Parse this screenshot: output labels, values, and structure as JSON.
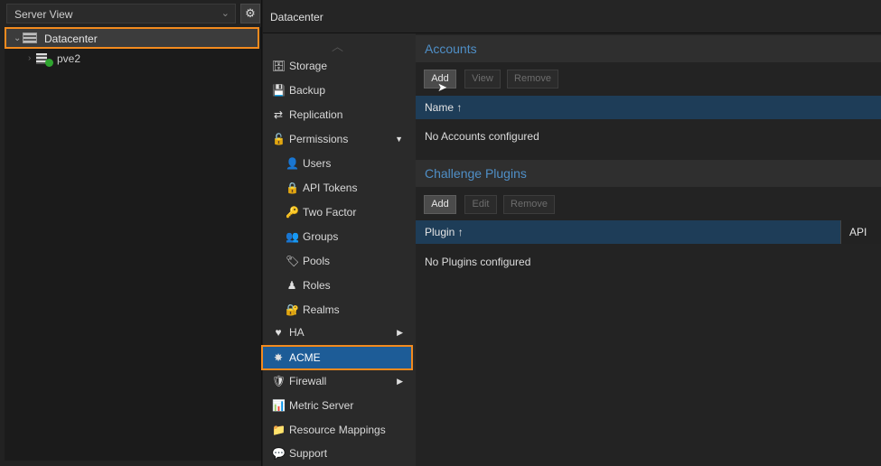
{
  "tree": {
    "view_label": "Server View",
    "view_caret": "⌄",
    "gear": "⚙",
    "nodes": [
      {
        "label": "Datacenter",
        "chevron": "⌄"
      },
      {
        "label": "pve2",
        "chevron": "›"
      }
    ]
  },
  "header": {
    "title": "Datacenter"
  },
  "menu": {
    "scroll_up": "︿",
    "items": [
      {
        "label": "Storage",
        "icon": "🗄"
      },
      {
        "label": "Backup",
        "icon": "💾"
      },
      {
        "label": "Replication",
        "icon": "⇄"
      },
      {
        "label": "Permissions",
        "icon": "🔓",
        "arrow": "▼"
      },
      {
        "label": "Users",
        "icon": "👤"
      },
      {
        "label": "API Tokens",
        "icon": "🔒"
      },
      {
        "label": "Two Factor",
        "icon": "🔑"
      },
      {
        "label": "Groups",
        "icon": "👥"
      },
      {
        "label": "Pools",
        "icon": "🏷"
      },
      {
        "label": "Roles",
        "icon": "♟"
      },
      {
        "label": "Realms",
        "icon": "🔐"
      },
      {
        "label": "HA",
        "icon": "♥",
        "arrow": "▶"
      },
      {
        "label": "ACME",
        "icon": "✸"
      },
      {
        "label": "Firewall",
        "icon": "🛡",
        "arrow": "▶"
      },
      {
        "label": "Metric Server",
        "icon": "📊"
      },
      {
        "label": "Resource Mappings",
        "icon": "📁"
      },
      {
        "label": "Support",
        "icon": "💬"
      }
    ],
    "selected": "ACME"
  },
  "accounts": {
    "title": "Accounts",
    "buttons": {
      "add": "Add",
      "view": "View",
      "remove": "Remove"
    },
    "column": "Name ↑",
    "empty": "No Accounts configured"
  },
  "plugins": {
    "title": "Challenge Plugins",
    "buttons": {
      "add": "Add",
      "edit": "Edit",
      "remove": "Remove"
    },
    "column": "Plugin ↑",
    "column2": "API",
    "empty": "No Plugins configured"
  },
  "colors": {
    "accent": "#f28a1e",
    "selected": "#1d5c97",
    "section_title": "#4f8fc7"
  }
}
